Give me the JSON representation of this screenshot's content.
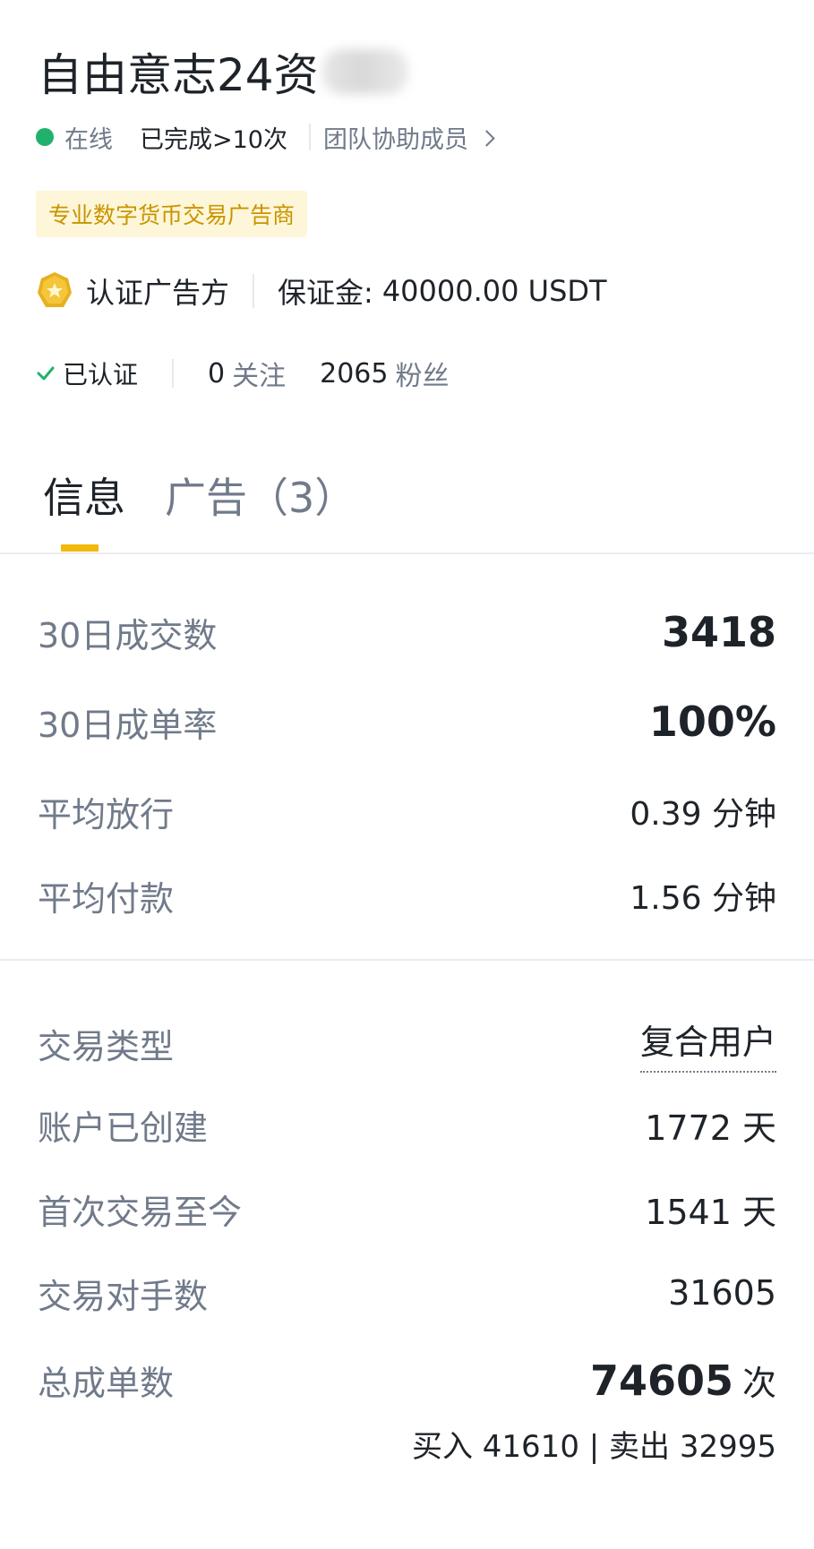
{
  "profile": {
    "name": "自由意志24资",
    "status": "在线",
    "completed": "已完成>10次",
    "team": "团队协助成员",
    "tag": "专业数字货币交易广告商",
    "certified_label": "认证广告方",
    "deposit_label": "保证金:",
    "deposit_value": "40000.00 USDT",
    "verified": "已认证",
    "following_count": "0",
    "following_label": "关注",
    "fans_count": "2065",
    "fans_label": "粉丝"
  },
  "tabs": {
    "info": "信息",
    "ads": "广告（3）"
  },
  "stats": [
    {
      "label": "30日成交数",
      "value": "3418"
    },
    {
      "label": "30日成单率",
      "value": "100%"
    },
    {
      "label": "平均放行",
      "value": "0.39 分钟"
    },
    {
      "label": "平均付款",
      "value": "1.56 分钟"
    }
  ],
  "details": [
    {
      "label": "交易类型",
      "value": "复合用户"
    },
    {
      "label": "账户已创建",
      "value": "1772 天"
    },
    {
      "label": "首次交易至今",
      "value": "1541 天"
    },
    {
      "label": "交易对手数",
      "value": "31605"
    }
  ],
  "total": {
    "label": "总成单数",
    "count": "74605",
    "unit": "次",
    "breakdown": "买入 41610 | 卖出 32995"
  },
  "colors": {
    "online": "#20b26c",
    "accent": "#f0b90b",
    "tag_bg": "#fef6d8",
    "tag_text": "#c99400",
    "muted": "#707a8a",
    "primary_text": "#1e2329"
  },
  "icons": {
    "status": "online-dot-icon",
    "team_link": "chevron-right-icon",
    "certified": "certified-badge-icon",
    "verified": "check-icon"
  }
}
